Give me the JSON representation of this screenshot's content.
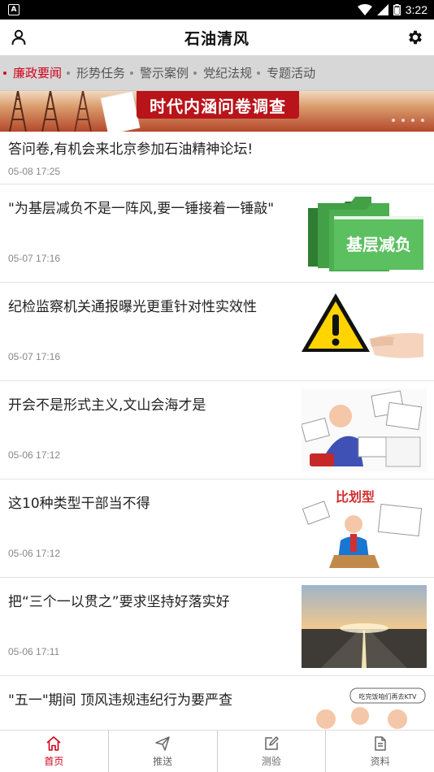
{
  "status_bar": {
    "notification_glyph": "A",
    "time": "3:22"
  },
  "header": {
    "title": "石油清风",
    "user_icon": "user-icon",
    "settings_icon": "gear-icon"
  },
  "tabs": [
    {
      "label": "廉政要闻",
      "active": true
    },
    {
      "label": "形势任务",
      "active": false
    },
    {
      "label": "警示案例",
      "active": false
    },
    {
      "label": "党纪法规",
      "active": false
    },
    {
      "label": "专题活动",
      "active": false
    }
  ],
  "banner": {
    "caption": "时代内涵问卷调查"
  },
  "news": [
    {
      "title": "答问卷,有机会来北京参加石油精神论坛!",
      "date": "05-08 17:25"
    },
    {
      "title": "\"为基层减负不是一阵风,要一锤接着一锤敲\"",
      "date": "05-07 17:16",
      "thumb_text": "基层减负"
    },
    {
      "title": "纪检监察机关通报曝光更重针对性实效性",
      "date": "05-07 17:16"
    },
    {
      "title": "开会不是形式主义,文山会海才是",
      "date": "05-06 17:12"
    },
    {
      "title": "这10种类型干部当不得",
      "date": "05-06 17:12",
      "thumb_text": "比划型"
    },
    {
      "title": "把“三个一以贯之”要求坚持好落实好",
      "date": "05-06 17:11"
    },
    {
      "title": "\"五一\"期间 顶风违规违纪行为要严查",
      "date": "",
      "thumb_text": "吃完饭咱们再去KTV"
    }
  ],
  "bottom_nav": [
    {
      "label": "首页",
      "icon": "home-icon",
      "active": true
    },
    {
      "label": "推送",
      "icon": "send-icon",
      "active": false
    },
    {
      "label": "测验",
      "icon": "edit-icon",
      "active": false
    },
    {
      "label": "资料",
      "icon": "document-icon",
      "active": false
    }
  ],
  "colors": {
    "accent": "#d0021b",
    "tab_bar": "#d7d7d7"
  }
}
